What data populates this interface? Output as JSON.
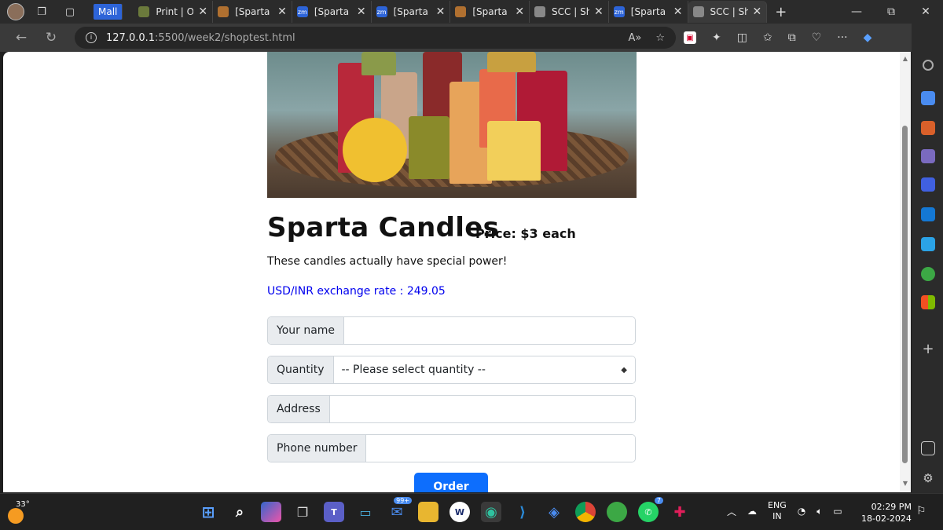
{
  "browser": {
    "tabs": [
      {
        "label": "Mall",
        "kind": "group"
      },
      {
        "label": "Print | Or",
        "favicon_color": "#6b7a3c"
      },
      {
        "label": "[Sparta C",
        "favicon_color": "#b07030"
      },
      {
        "label": "[Sparta C",
        "favicon_color": "#2d64d8",
        "favicon_text": "zm"
      },
      {
        "label": "[Sparta C",
        "favicon_color": "#2d64d8",
        "favicon_text": "zm"
      },
      {
        "label": "[Sparta C",
        "favicon_color": "#b07030"
      },
      {
        "label": "SCC | Sh",
        "favicon_color": "#888888"
      },
      {
        "label": "[Sparta C",
        "favicon_color": "#2d64d8",
        "favicon_text": "zm"
      },
      {
        "label": "SCC | Sh",
        "favicon_color": "#888888",
        "active": true
      }
    ],
    "url_host": "127.0.0.1",
    "url_path": ":5500/week2/shoptest.html"
  },
  "page": {
    "title": "Sparta Candles",
    "price": "Price: $3 each",
    "description": "These candles actually have special power!",
    "exchange_rate": "USD/INR exchange rate : 249.05",
    "form": {
      "name_label": "Your name",
      "quantity_label": "Quantity",
      "quantity_selected": "-- Please select quantity --",
      "address_label": "Address",
      "phone_label": "Phone number"
    },
    "order_button": "Order"
  },
  "taskbar": {
    "temperature": "33°",
    "mail_badge": "99+",
    "whatsapp_badge": "7",
    "lang_top": "ENG",
    "lang_bottom": "IN",
    "time": "02:29 PM",
    "date": "18-02-2024"
  }
}
